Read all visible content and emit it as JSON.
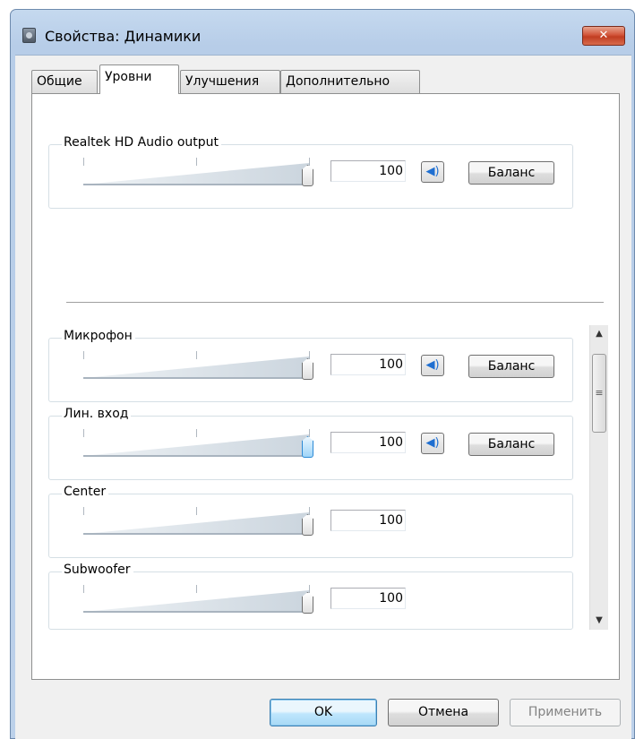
{
  "window": {
    "title": "Свойства: Динамики",
    "close_label": "✕"
  },
  "tabs": [
    {
      "label": "Общие"
    },
    {
      "label": "Уровни"
    },
    {
      "label": "Улучшения"
    },
    {
      "label": "Дополнительно"
    }
  ],
  "master": {
    "label": "Realtek HD Audio output",
    "value": "100",
    "balance_label": "Баланс",
    "mute_icon": "speaker-icon"
  },
  "channels": [
    {
      "label": "Микрофон",
      "value": "100",
      "balance_label": "Баланс",
      "has_controls": true
    },
    {
      "label": "Лин. вход",
      "value": "100",
      "balance_label": "Баланс",
      "has_controls": true
    },
    {
      "label": "Center",
      "value": "100"
    },
    {
      "label": "Subwoofer",
      "value": "100"
    }
  ],
  "scrollbar": {
    "up_icon": "▲",
    "down_icon": "▼",
    "grip_icon": "≡"
  },
  "buttons": {
    "ok": "OK",
    "cancel": "Отмена",
    "apply": "Применить"
  },
  "colors": {
    "accent": "#1f6fd1",
    "close": "#c13d22"
  }
}
